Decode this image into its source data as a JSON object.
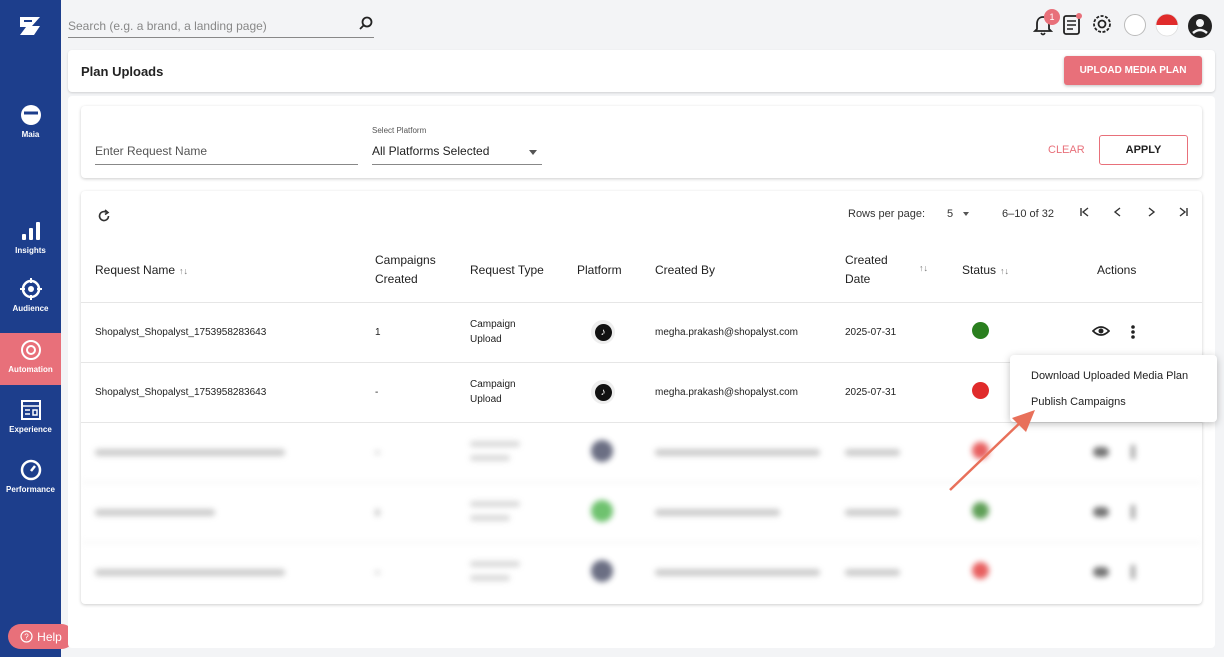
{
  "search": {
    "placeholder": "Search (e.g. a brand, a landing page)"
  },
  "notifications": {
    "count": "1"
  },
  "sidebar": {
    "items": [
      {
        "label": "Maia",
        "icon": "maia-icon"
      },
      {
        "label": "Insights",
        "icon": "bar-chart-icon"
      },
      {
        "label": "Audience",
        "icon": "target-icon"
      },
      {
        "label": "Automation",
        "icon": "gear-icon"
      },
      {
        "label": "Experience",
        "icon": "layout-icon"
      },
      {
        "label": "Performance",
        "icon": "gauge-icon"
      }
    ],
    "help_label": "Help"
  },
  "header": {
    "title": "Plan Uploads",
    "upload_label": "UPLOAD MEDIA PLAN"
  },
  "filter": {
    "request_placeholder": "Enter Request Name",
    "platform_label": "Select Platform",
    "platform_value": "All Platforms Selected",
    "clear_label": "CLEAR",
    "apply_label": "APPLY"
  },
  "pagination": {
    "rows_label": "Rows per page:",
    "rows_value": "5",
    "range": "6–10 of 32"
  },
  "table": {
    "columns": {
      "request_name": "Request Name",
      "campaigns_1": "Campaigns",
      "campaigns_2": "Created",
      "request_type": "Request Type",
      "platform": "Platform",
      "created_by": "Created By",
      "created_1": "Created",
      "created_2": "Date",
      "status": "Status",
      "actions": "Actions"
    },
    "rows": [
      {
        "name": "Shopalyst_Shopalyst_1753958283643",
        "campaigns": "1",
        "type_1": "Campaign",
        "type_2": "Upload",
        "created_by": "megha.prakash@shopalyst.com",
        "date": "2025-07-31",
        "status_color": "#2a7f1f"
      },
      {
        "name": "Shopalyst_Shopalyst_1753958283643",
        "campaigns": "-",
        "type_1": "Campaign",
        "type_2": "Upload",
        "created_by": "megha.prakash@shopalyst.com",
        "date": "2025-07-31",
        "status_color": "#e02b2b"
      }
    ]
  },
  "menu": {
    "download_label": "Download Uploaded Media Plan",
    "publish_label": "Publish Campaigns"
  },
  "colors": {
    "sidebar": "#1d3e8c",
    "accent": "#e8707a",
    "status_green": "#2a7f1f",
    "status_red": "#e02b2b"
  }
}
